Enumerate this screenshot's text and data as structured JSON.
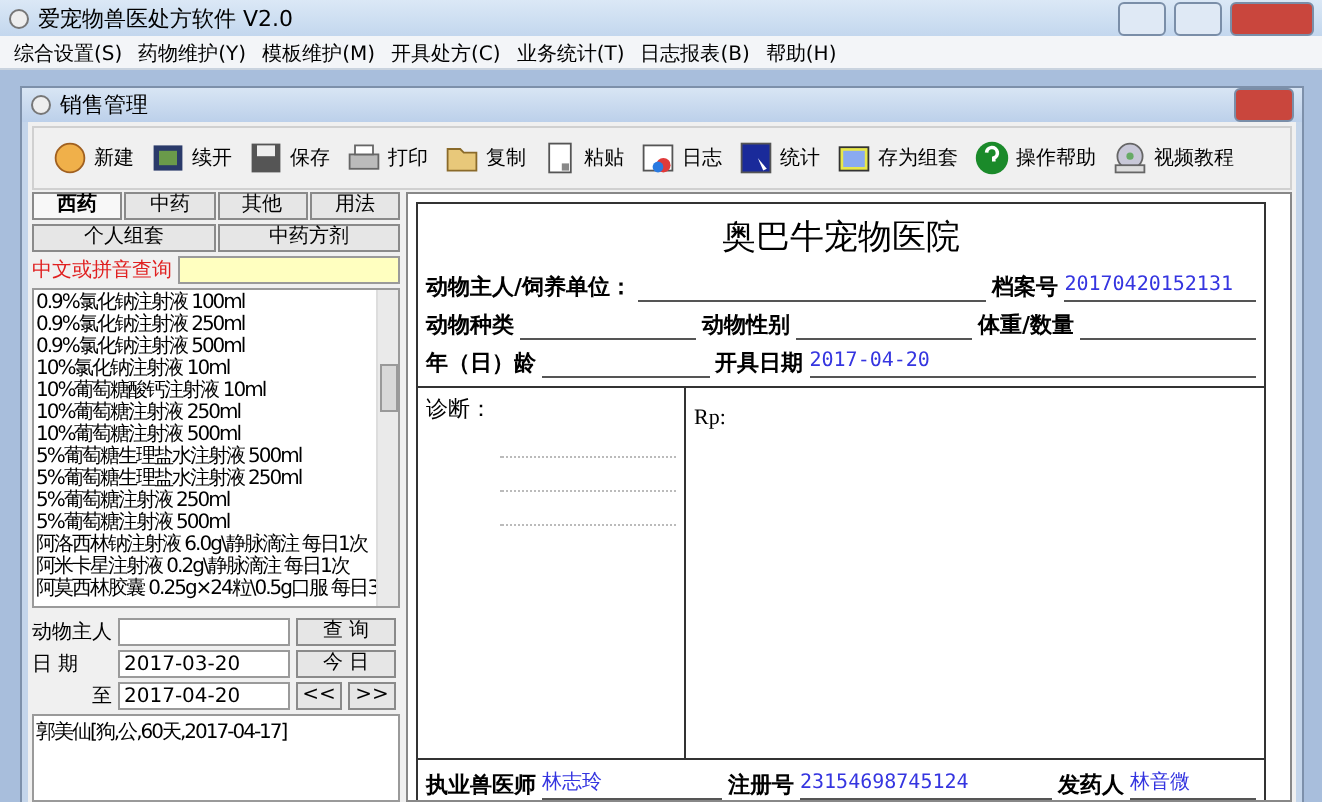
{
  "window": {
    "title": "爱宠物兽医处方软件 V2.0"
  },
  "menu": [
    "综合设置(S)",
    "药物维护(Y)",
    "模板维护(M)",
    "开具处方(C)",
    "业务统计(T)",
    "日志报表(B)",
    "帮助(H)"
  ],
  "inner_window": {
    "title": "销售管理"
  },
  "toolbar": [
    "新建",
    "续开",
    "保存",
    "打印",
    "复制",
    "粘贴",
    "日志",
    "统计",
    "存为组套",
    "操作帮助",
    "视频教程"
  ],
  "left_panel": {
    "tabs": [
      {
        "label": "西药",
        "selected": true
      },
      {
        "label": "中药",
        "selected": false
      },
      {
        "label": "其他",
        "selected": false
      },
      {
        "label": "用法",
        "selected": false
      }
    ],
    "sub_tabs": [
      {
        "label": "个人组套"
      },
      {
        "label": "中药方剂"
      }
    ],
    "search": {
      "label": "中文或拼音查询"
    },
    "drug_list": [
      "0.9%氯化钠注射液  100ml",
      "0.9%氯化钠注射液  250ml",
      "0.9%氯化钠注射液  500ml",
      "10%氯化钠注射液  10ml",
      "10%葡萄糖酸钙注射液  10ml",
      "10%葡萄糖注射液  250ml",
      "10%葡萄糖注射液  500ml",
      "5%葡萄糖生理盐水注射液  500ml",
      "5%葡萄糖生理盐水注射液 250ml",
      "5%葡萄糖注射液  250ml",
      "5%葡萄糖注射液  500ml",
      "阿洛西林钠注射液 6.0g\\静脉滴注  每日1次",
      "阿米卡星注射液  0.2g\\静脉滴注  每日1次",
      "阿莫西林胶囊 0.25g×24粒\\0.5g口服 每日3"
    ],
    "query": {
      "owner_label": "动物主人",
      "query_button": "查 询",
      "date_label": "日  期",
      "date_from": "2017-03-20",
      "today_button": "今 日",
      "to_label": "至",
      "date_to": "2017-04-20",
      "prev_button": "<<",
      "next_button": ">>"
    },
    "results": [
      "郭美仙[狗,公,60天,2017-04-17]"
    ]
  },
  "prescription": {
    "hospital": "奥巴牛宠物医院",
    "owner_label": "动物主人/饲养单位：",
    "file_no_label": "档案号",
    "file_no": "20170420152131",
    "species_label": "动物种类",
    "sex_label": "动物性别",
    "weight_label": "体重/数量",
    "age_label": "年（日）龄",
    "date_label": "开具日期",
    "date": "2017-04-20",
    "diagnosis_label": "诊断：",
    "rp_label": "Rp:",
    "vet_label": "执业兽医师",
    "vet": "林志玲",
    "reg_label": "注册号",
    "reg_no": "23154698745124",
    "dispenser_label": "发药人",
    "dispenser": "林音微"
  }
}
